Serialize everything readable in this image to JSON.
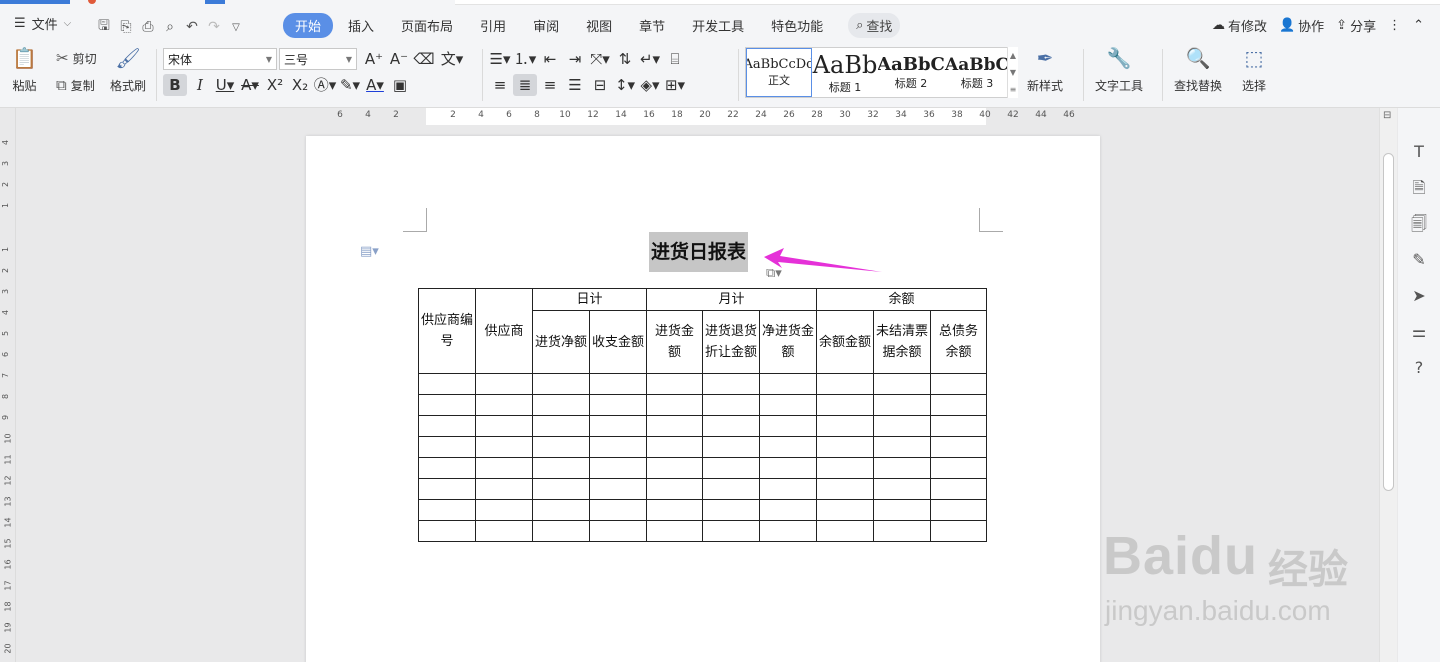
{
  "menu": {
    "file_label": "文件",
    "tabs": [
      "开始",
      "插入",
      "页面布局",
      "引用",
      "审阅",
      "视图",
      "章节",
      "开发工具",
      "特色功能"
    ],
    "search_label": "查找",
    "right": {
      "modified": "有修改",
      "collab": "协作",
      "share": "分享"
    }
  },
  "ribbon": {
    "paste": "粘贴",
    "cut": "剪切",
    "copy": "复制",
    "format_painter": "格式刷",
    "font_name": "宋体",
    "font_size": "三号",
    "styles": [
      {
        "sample": "AaBbCcDd",
        "label": "正文"
      },
      {
        "sample": "AaBb",
        "label": "标题 1"
      },
      {
        "sample": "AaBbC",
        "label": "标题 2"
      },
      {
        "sample": "AaBbC",
        "label": "标题 3"
      }
    ],
    "new_style": "新样式",
    "text_tools": "文字工具",
    "find_replace": "查找替换",
    "select": "选择"
  },
  "ruler_numbers": [
    "6",
    "4",
    "2",
    "2",
    "4",
    "6",
    "8",
    "10",
    "12",
    "14",
    "16",
    "18",
    "20",
    "22",
    "24",
    "26",
    "28",
    "30",
    "32",
    "34",
    "36",
    "38",
    "40",
    "42",
    "44",
    "46"
  ],
  "vruler_numbers": [
    "4",
    "3",
    "2",
    "1",
    "1",
    "2",
    "3",
    "4",
    "5",
    "6",
    "7",
    "8",
    "9",
    "10",
    "11",
    "12",
    "13",
    "14",
    "15",
    "16",
    "17",
    "18",
    "19",
    "20"
  ],
  "document": {
    "title": "进货日报表",
    "table": {
      "group_headers": [
        "日计",
        "月计",
        "余额"
      ],
      "col_supplier_code": "供应商编号",
      "col_supplier": "供应商",
      "sub_headers": [
        "进货净额",
        "收支金额",
        "进货金额",
        "进货退货折让金额",
        "净进货金额",
        "余额金额",
        "未结清票据余额",
        "总债务余额"
      ],
      "empty_rows": 8
    }
  },
  "watermark": {
    "brand": "Bai",
    "brand2": "du",
    "cn": "经验",
    "url": "jingyan.baidu.com"
  },
  "colors": {
    "accent": "#5a8fe6",
    "arrow": "#e531d8"
  }
}
